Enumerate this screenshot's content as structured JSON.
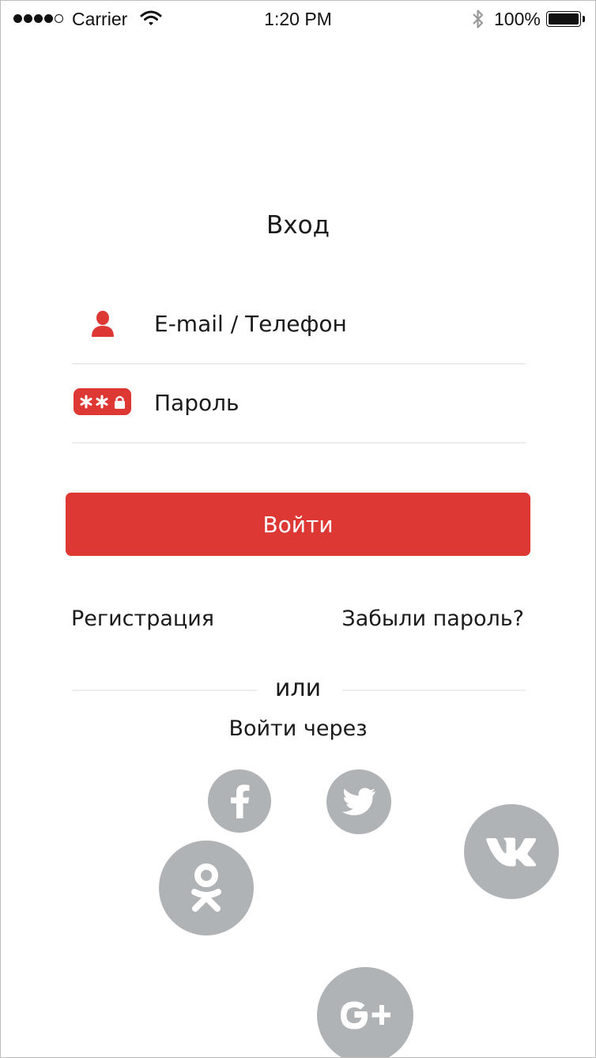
{
  "status_bar": {
    "carrier": "Carrier",
    "time": "1:20 PM",
    "battery": "100%"
  },
  "login": {
    "title": "Вход",
    "email_placeholder": "E-mail / Телефон",
    "password_placeholder": "Пароль",
    "submit_label": "Войти",
    "register_link": "Регистрация",
    "forgot_link": "Забыли пароль?",
    "divider_text": "или",
    "social_caption": "Войти через"
  },
  "social": [
    {
      "name": "facebook",
      "icon": "facebook-icon"
    },
    {
      "name": "twitter",
      "icon": "twitter-icon"
    },
    {
      "name": "vk",
      "icon": "vk-icon"
    },
    {
      "name": "odnoklassniki",
      "icon": "odnoklassniki-icon"
    },
    {
      "name": "google-plus",
      "icon": "google-plus-icon"
    }
  ],
  "colors": {
    "accent": "#dd3834",
    "social_gray": "#b0b3b6",
    "divider": "#ededed"
  }
}
